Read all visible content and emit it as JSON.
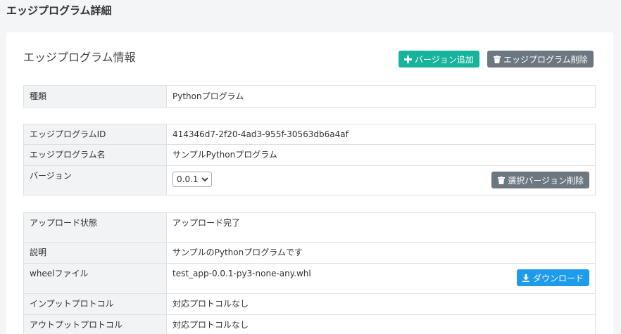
{
  "page": {
    "title": "エッジプログラム詳細"
  },
  "card": {
    "title": "エッジプログラム情報",
    "add_version_label": "バージョン追加",
    "delete_program_label": "エッジプログラム削除"
  },
  "type_table": {
    "rows": [
      {
        "key": "種類",
        "value": "Pythonプログラム"
      }
    ]
  },
  "program_table": {
    "id_key": "エッジプログラムID",
    "id_value": "414346d7-2f20-4ad3-955f-30563db6a4af",
    "name_key": "エッジプログラム名",
    "name_value": "サンプルPythonプログラム",
    "version_key": "バージョン",
    "version_selected": "0.0.1",
    "delete_version_label": "選択バージョン削除"
  },
  "version_table": {
    "upload_key": "アップロード状態",
    "upload_value": "アップロード完了",
    "desc_key": "説明",
    "desc_value": "サンプルのPythonプログラムです",
    "wheel_key": "wheelファイル",
    "wheel_value": "test_app-0.0.1-py3-none-any.whl",
    "download_label": "ダウンロード",
    "input_key": "インプットプロトコル",
    "input_value": "対応プロトコルなし",
    "output_key": "アウトプットプロトコル",
    "output_value": "対応プロトコルなし"
  },
  "icons": {
    "plus": "plus-icon",
    "trash": "trash-icon",
    "download": "download-icon",
    "chevron": "chevron-down-icon"
  },
  "colors": {
    "teal": "#18b39b",
    "gray": "#6c7780",
    "blue": "#1e9bea"
  }
}
